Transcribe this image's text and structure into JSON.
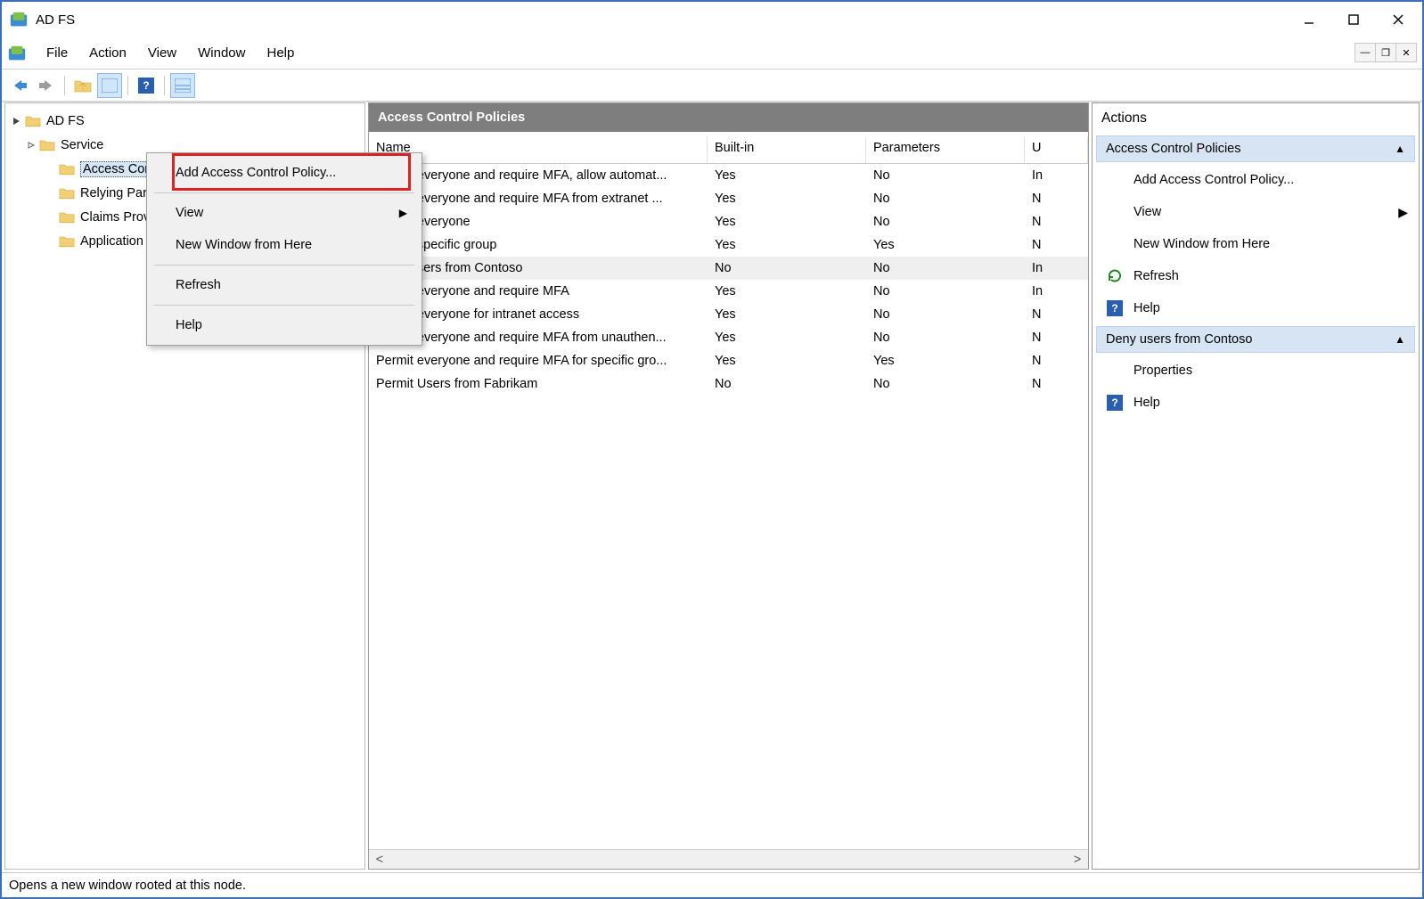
{
  "window": {
    "title": "AD FS"
  },
  "menubar": {
    "items": [
      "File",
      "Action",
      "View",
      "Window",
      "Help"
    ]
  },
  "tree": {
    "root": "AD FS",
    "items": [
      {
        "label": "Service",
        "indent": 1,
        "expandable": true
      },
      {
        "label": "Access Control Policies",
        "indent": 2,
        "selected": true
      },
      {
        "label": "Relying Party Trusts",
        "indent": 2
      },
      {
        "label": "Claims Provider Trusts",
        "indent": 2
      },
      {
        "label": "Application Groups",
        "indent": 2
      }
    ]
  },
  "context_menu": {
    "items": [
      {
        "label": "Add Access Control Policy...",
        "highlighted": true
      },
      {
        "sep": true
      },
      {
        "label": "View",
        "submenu": true
      },
      {
        "label": "New Window from Here"
      },
      {
        "sep": true
      },
      {
        "label": "Refresh"
      },
      {
        "sep": true
      },
      {
        "label": "Help"
      }
    ]
  },
  "mid": {
    "header": "Access Control Policies",
    "columns": [
      "Name",
      "Built-in",
      "Parameters",
      "U"
    ],
    "rows": [
      {
        "name": "Permit everyone and require MFA, allow automat...",
        "builtin": "Yes",
        "params": "No",
        "u": "In"
      },
      {
        "name": "Permit everyone and require MFA from extranet ...",
        "builtin": "Yes",
        "params": "No",
        "u": "N"
      },
      {
        "name": "Permit everyone",
        "builtin": "Yes",
        "params": "No",
        "u": "N"
      },
      {
        "name": "Permit specific group",
        "builtin": "Yes",
        "params": "Yes",
        "u": "N"
      },
      {
        "name": "Deny users from Contoso",
        "builtin": "No",
        "params": "No",
        "u": "In",
        "selected": true
      },
      {
        "name": "Permit everyone and require MFA",
        "builtin": "Yes",
        "params": "No",
        "u": "In"
      },
      {
        "name": "Permit everyone for intranet access",
        "builtin": "Yes",
        "params": "No",
        "u": "N"
      },
      {
        "name": "Permit everyone and require MFA from unauthen...",
        "builtin": "Yes",
        "params": "No",
        "u": "N"
      },
      {
        "name": "Permit everyone and require MFA for specific gro...",
        "builtin": "Yes",
        "params": "Yes",
        "u": "N"
      },
      {
        "name": "Permit Users from Fabrikam",
        "builtin": "No",
        "params": "No",
        "u": "N"
      }
    ]
  },
  "actions": {
    "title": "Actions",
    "groups": [
      {
        "header": "Access Control Policies",
        "items": [
          {
            "label": "Add Access Control Policy...",
            "icon": ""
          },
          {
            "label": "View",
            "icon": "",
            "submenu": true
          },
          {
            "label": "New Window from Here",
            "icon": ""
          },
          {
            "label": "Refresh",
            "icon": "refresh"
          },
          {
            "label": "Help",
            "icon": "help"
          }
        ]
      },
      {
        "header": "Deny users from Contoso",
        "items": [
          {
            "label": "Properties",
            "icon": ""
          },
          {
            "label": "Help",
            "icon": "help"
          }
        ]
      }
    ]
  },
  "statusbar": "Opens a new window rooted at this node."
}
